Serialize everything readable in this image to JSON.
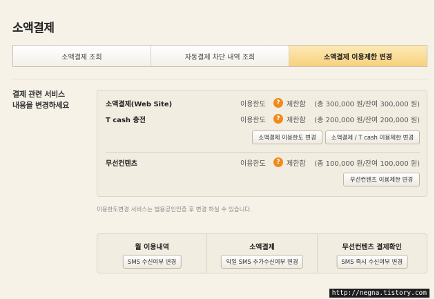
{
  "page": {
    "title": "소액결제"
  },
  "tabs": [
    {
      "label": "소액결제 조회",
      "active": false
    },
    {
      "label": "자동결제 차단 내역 조회",
      "active": false
    },
    {
      "label": "소액결제 이용제한 변경",
      "active": true
    }
  ],
  "side": {
    "line1": "결제 관련 서비스",
    "line2": "내용을 변경하세요"
  },
  "services": [
    {
      "name": "소액결제(Web Site)",
      "limit_label": "이용한도",
      "icon": "?",
      "status": "제한함",
      "amount": "(총 300,000 원/잔여 300,000 원)"
    },
    {
      "name": "T cash 충전",
      "limit_label": "이용한도",
      "icon": "?",
      "status": "제한함",
      "amount": "(총 200,000 원/잔여 200,000 원)"
    },
    {
      "name": "무선컨텐츠",
      "limit_label": "이용한도",
      "icon": "?",
      "status": "제한함",
      "amount": "(총 100,000 원/잔여 100,000 원)"
    }
  ],
  "buttons": {
    "change_limit": "소액결제 이용한도 변경",
    "change_restriction": "소액결제 / T cash 이용제한 변경",
    "wireless_restriction": "무선컨텐츠 이용제한 변경"
  },
  "note": "이용한도변경 서비스는 법용공인인증 후 변경 하실 수 있습니다.",
  "bottom": [
    {
      "title": "월 이용내역",
      "button": "SMS 수신여부 변경"
    },
    {
      "title": "소액결제",
      "button": "익일 SMS 추가수신여부 변경"
    },
    {
      "title": "무선컨텐츠 결제확인",
      "button": "SMS 즉시 수신여부 변경"
    }
  ],
  "watermark": "http://negna.tistory.com",
  "colors": {
    "accent": "#f7d27d",
    "warning": "#f08a1c",
    "background": "#f6f2e8"
  }
}
